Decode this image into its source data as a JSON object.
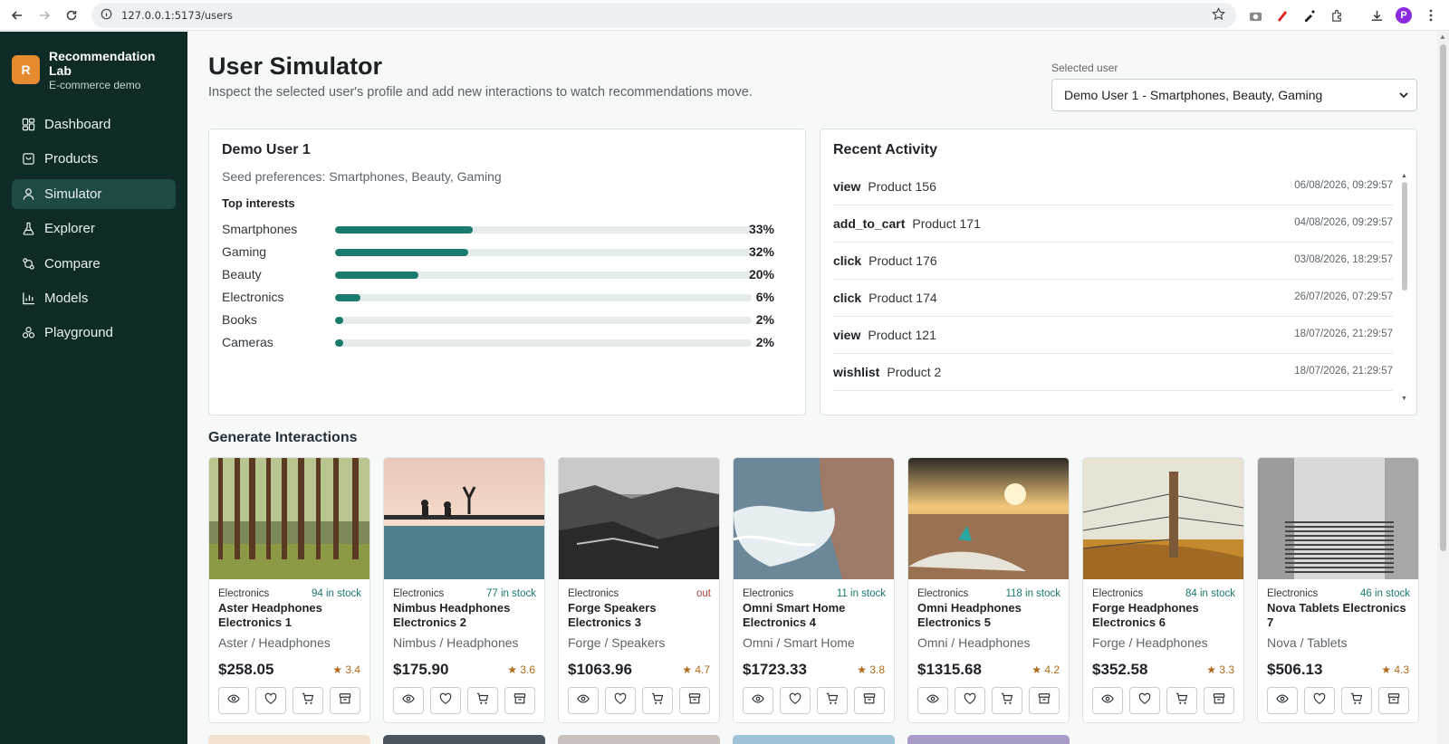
{
  "browser": {
    "url": "127.0.0.1:5173/users",
    "profile_initial": "P"
  },
  "brand": {
    "logo_letter": "R",
    "name": "Recommendation Lab",
    "subtitle": "E-commerce demo"
  },
  "nav": [
    {
      "label": "Dashboard",
      "icon": "dashboard-icon"
    },
    {
      "label": "Products",
      "icon": "bag-icon"
    },
    {
      "label": "Simulator",
      "icon": "user-icon",
      "active": true
    },
    {
      "label": "Explorer",
      "icon": "flask-icon"
    },
    {
      "label": "Compare",
      "icon": "compare-icon"
    },
    {
      "label": "Models",
      "icon": "bar-chart-icon"
    },
    {
      "label": "Playground",
      "icon": "playground-icon"
    }
  ],
  "header": {
    "title": "User Simulator",
    "subtitle": "Inspect the selected user's profile and add new interactions to watch recommendations move.",
    "selected_user_label": "Selected user",
    "selected_user_value": "Demo User 1 - Smartphones, Beauty, Gaming"
  },
  "profile": {
    "name": "Demo User 1",
    "seed": "Seed preferences: Smartphones, Beauty, Gaming",
    "top_interests_label": "Top interests",
    "interests": [
      {
        "label": "Smartphones",
        "pct": "33%",
        "value": 0.33
      },
      {
        "label": "Gaming",
        "pct": "32%",
        "value": 0.32
      },
      {
        "label": "Beauty",
        "pct": "20%",
        "value": 0.2
      },
      {
        "label": "Electronics",
        "pct": "6%",
        "value": 0.06
      },
      {
        "label": "Books",
        "pct": "2%",
        "value": 0.02
      },
      {
        "label": "Cameras",
        "pct": "2%",
        "value": 0.02
      }
    ]
  },
  "activity": {
    "title": "Recent Activity",
    "items": [
      {
        "kind": "view",
        "product": "Product 156",
        "ts": "06/08/2026, 09:29:57"
      },
      {
        "kind": "add_to_cart",
        "product": "Product 171",
        "ts": "04/08/2026, 09:29:57"
      },
      {
        "kind": "click",
        "product": "Product 176",
        "ts": "03/08/2026, 18:29:57"
      },
      {
        "kind": "click",
        "product": "Product 174",
        "ts": "26/07/2026, 07:29:57"
      },
      {
        "kind": "view",
        "product": "Product 121",
        "ts": "18/07/2026, 21:29:57"
      },
      {
        "kind": "wishlist",
        "product": "Product 2",
        "ts": "18/07/2026, 21:29:57"
      }
    ]
  },
  "generate": {
    "title": "Generate Interactions",
    "products": [
      {
        "category": "Electronics",
        "stock": "94 in stock",
        "name": "Aster Headphones Electronics 1",
        "brand": "Aster / Headphones",
        "price": "$258.05",
        "rating": "3.4",
        "image": "forest"
      },
      {
        "category": "Electronics",
        "stock": "77 in stock",
        "name": "Nimbus Headphones Electronics 2",
        "brand": "Nimbus / Headphones",
        "price": "$175.90",
        "rating": "3.6",
        "image": "pier"
      },
      {
        "category": "Electronics",
        "stock": "out",
        "out": true,
        "name": "Forge Speakers Electronics 3",
        "brand": "Forge / Speakers",
        "price": "$1063.96",
        "rating": "4.7",
        "image": "rocks"
      },
      {
        "category": "Electronics",
        "stock": "11 in stock",
        "name": "Omni Smart Home Electronics 4",
        "brand": "Omni / Smart Home",
        "price": "$1723.33",
        "rating": "3.8",
        "image": "waves"
      },
      {
        "category": "Electronics",
        "stock": "118 in stock",
        "name": "Omni Headphones Electronics 5",
        "brand": "Omni / Headphones",
        "price": "$1315.68",
        "rating": "4.2",
        "image": "beach"
      },
      {
        "category": "Electronics",
        "stock": "84 in stock",
        "name": "Forge Headphones Electronics 6",
        "brand": "Forge / Headphones",
        "price": "$352.58",
        "rating": "3.3",
        "image": "fence"
      },
      {
        "category": "Electronics",
        "stock": "46 in stock",
        "name": "Nova Tablets Electronics 7",
        "brand": "Nova / Tablets",
        "price": "$506.13",
        "rating": "4.3",
        "image": "stairs"
      }
    ]
  },
  "colors": {
    "sidebar": "#0e2b28",
    "accent": "#1a7a6e",
    "logo": "#e58a2e",
    "rating": "#b06a1b",
    "out_of_stock": "#b5443a"
  }
}
